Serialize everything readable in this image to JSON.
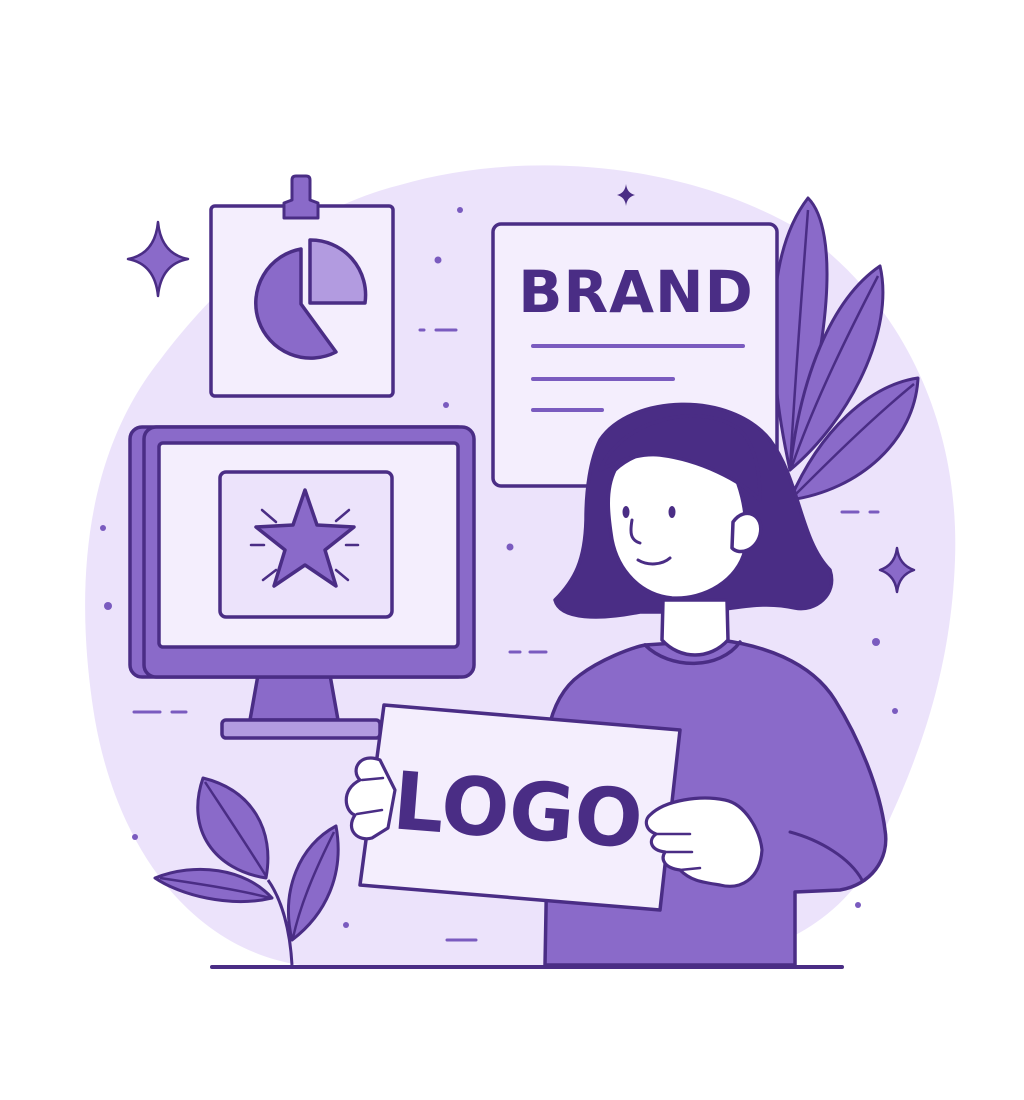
{
  "brand_card": {
    "title": "BRAND"
  },
  "logo_sign": {
    "text": "LOGO"
  },
  "colors": {
    "outline": "#4a2d85",
    "blob_background": "#ece3fb",
    "card_fill": "#efe7fc",
    "primary_purple": "#8a6ac9",
    "light_purple": "#b29be0",
    "hair": "#4a2d85",
    "skin": "#ffffff"
  }
}
